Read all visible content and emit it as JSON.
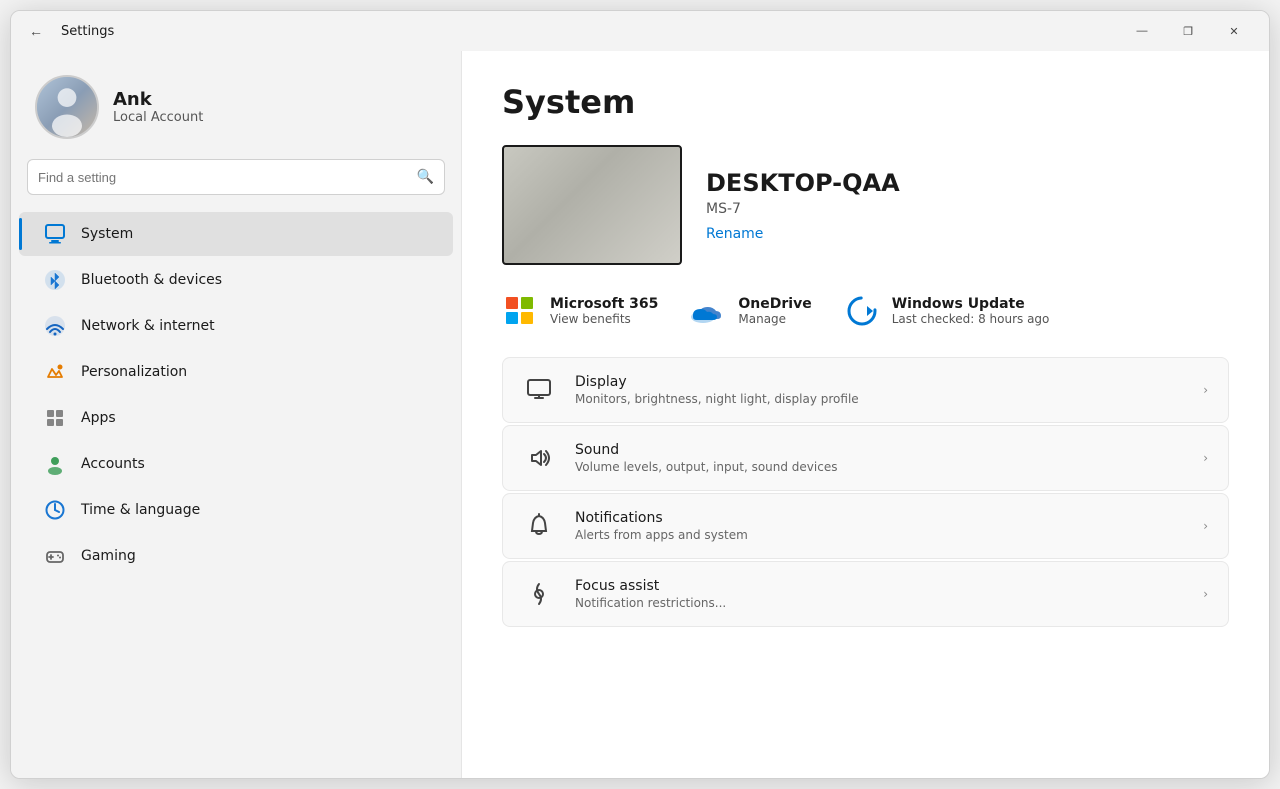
{
  "window": {
    "title": "Settings",
    "controls": {
      "minimize": "—",
      "maximize": "❐",
      "close": "✕"
    }
  },
  "sidebar": {
    "user": {
      "name": "Ank",
      "subtitle": "Local Account"
    },
    "search": {
      "placeholder": "Find a setting"
    },
    "nav": [
      {
        "id": "system",
        "label": "System",
        "icon": "🖥",
        "active": true
      },
      {
        "id": "bluetooth",
        "label": "Bluetooth & devices",
        "icon": "bluetooth",
        "active": false
      },
      {
        "id": "network",
        "label": "Network & internet",
        "icon": "wifi",
        "active": false
      },
      {
        "id": "personalization",
        "label": "Personalization",
        "icon": "✏️",
        "active": false
      },
      {
        "id": "apps",
        "label": "Apps",
        "icon": "apps",
        "active": false
      },
      {
        "id": "accounts",
        "label": "Accounts",
        "icon": "accounts",
        "active": false
      },
      {
        "id": "time",
        "label": "Time & language",
        "icon": "🌐",
        "active": false
      },
      {
        "id": "gaming",
        "label": "Gaming",
        "icon": "🎮",
        "active": false
      }
    ]
  },
  "main": {
    "title": "System",
    "pc": {
      "name": "DESKTOP-QAA",
      "model": "MS-7",
      "rename_label": "Rename"
    },
    "quick_links": [
      {
        "id": "microsoft365",
        "title": "Microsoft 365",
        "subtitle": "View benefits"
      },
      {
        "id": "onedrive",
        "title": "OneDrive",
        "subtitle": "Manage"
      },
      {
        "id": "windowsupdate",
        "title": "Windows Update",
        "subtitle": "Last checked: 8 hours ago"
      }
    ],
    "settings_items": [
      {
        "id": "display",
        "title": "Display",
        "desc": "Monitors, brightness, night light, display profile",
        "icon": "display"
      },
      {
        "id": "sound",
        "title": "Sound",
        "desc": "Volume levels, output, input, sound devices",
        "icon": "sound"
      },
      {
        "id": "notifications",
        "title": "Notifications",
        "desc": "Alerts from apps and system",
        "icon": "notifications"
      },
      {
        "id": "focus",
        "title": "Focus assist",
        "desc": "Notification restrictions...",
        "icon": "focus"
      }
    ]
  }
}
